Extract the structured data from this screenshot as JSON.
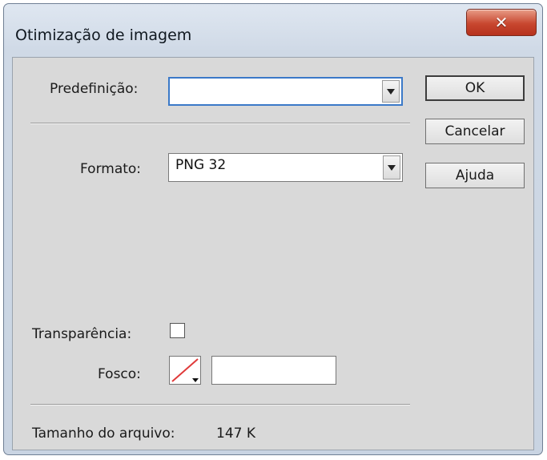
{
  "dialog": {
    "title": "Otimização de imagem",
    "close_glyph": "✕"
  },
  "preset": {
    "label": "Predefinição:",
    "value": ""
  },
  "buttons": {
    "ok": "OK",
    "cancel": "Cancelar",
    "help": "Ajuda"
  },
  "format": {
    "label": "Formato:",
    "value": "PNG 32"
  },
  "transparency": {
    "label": "Transparência:",
    "checked": false
  },
  "matte": {
    "label": "Fosco:",
    "value": ""
  },
  "file_size": {
    "label": "Tamanho do arquivo:",
    "value": "147 K"
  },
  "colors": {
    "close_button": "#c8472f",
    "focus_border": "#3b79c8",
    "swatch_slash": "#e03a3a"
  }
}
